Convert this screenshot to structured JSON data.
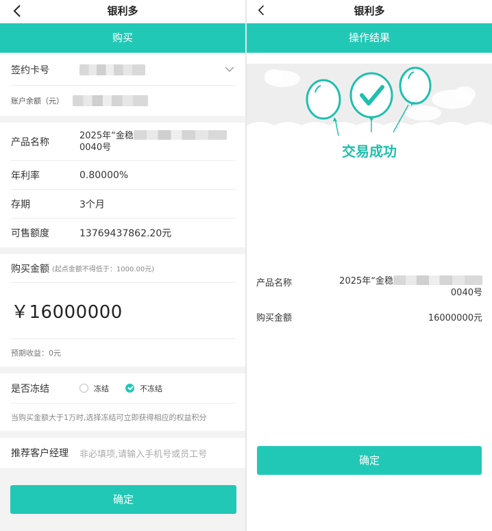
{
  "left": {
    "nav_title": "银利多",
    "banner": "购买",
    "card": {
      "label": "签约卡号"
    },
    "balance": {
      "label": "账户余额（元）"
    },
    "product": {
      "name_label": "产品名称",
      "name_prefix": "2025年“金稳",
      "name_suffix": "0040号",
      "rate_label": "年利率",
      "rate_value": "0.80000%",
      "term_label": "存期",
      "term_value": "3个月",
      "quota_label": "可售额度",
      "quota_value": "13769437862.20元"
    },
    "purchase": {
      "title": "购买金额",
      "hint": "(起点金额不得低于：1000.00元)",
      "amount": "￥16000000",
      "expected": "预期收益：0元"
    },
    "freeze": {
      "label": "是否冻结",
      "opt1": "冻结",
      "opt2": "不冻结",
      "note": "当购买金额大于1万时,选择冻结可立即获得相应的权益积分"
    },
    "manager": {
      "label": "推荐客户经理",
      "placeholder": "非必填项,请输入手机号或员工号"
    },
    "confirm": "确定"
  },
  "right": {
    "nav_title": "银利多",
    "banner": "操作结果",
    "success": "交易成功",
    "product_label": "产品名称",
    "product_prefix": "2025年“金稳",
    "product_suffix": "0040号",
    "amount_label": "购买金额",
    "amount_value": "16000000元",
    "confirm": "确定"
  },
  "colors": {
    "accent": "#22c8b6",
    "success_text": "#1fbfae"
  }
}
